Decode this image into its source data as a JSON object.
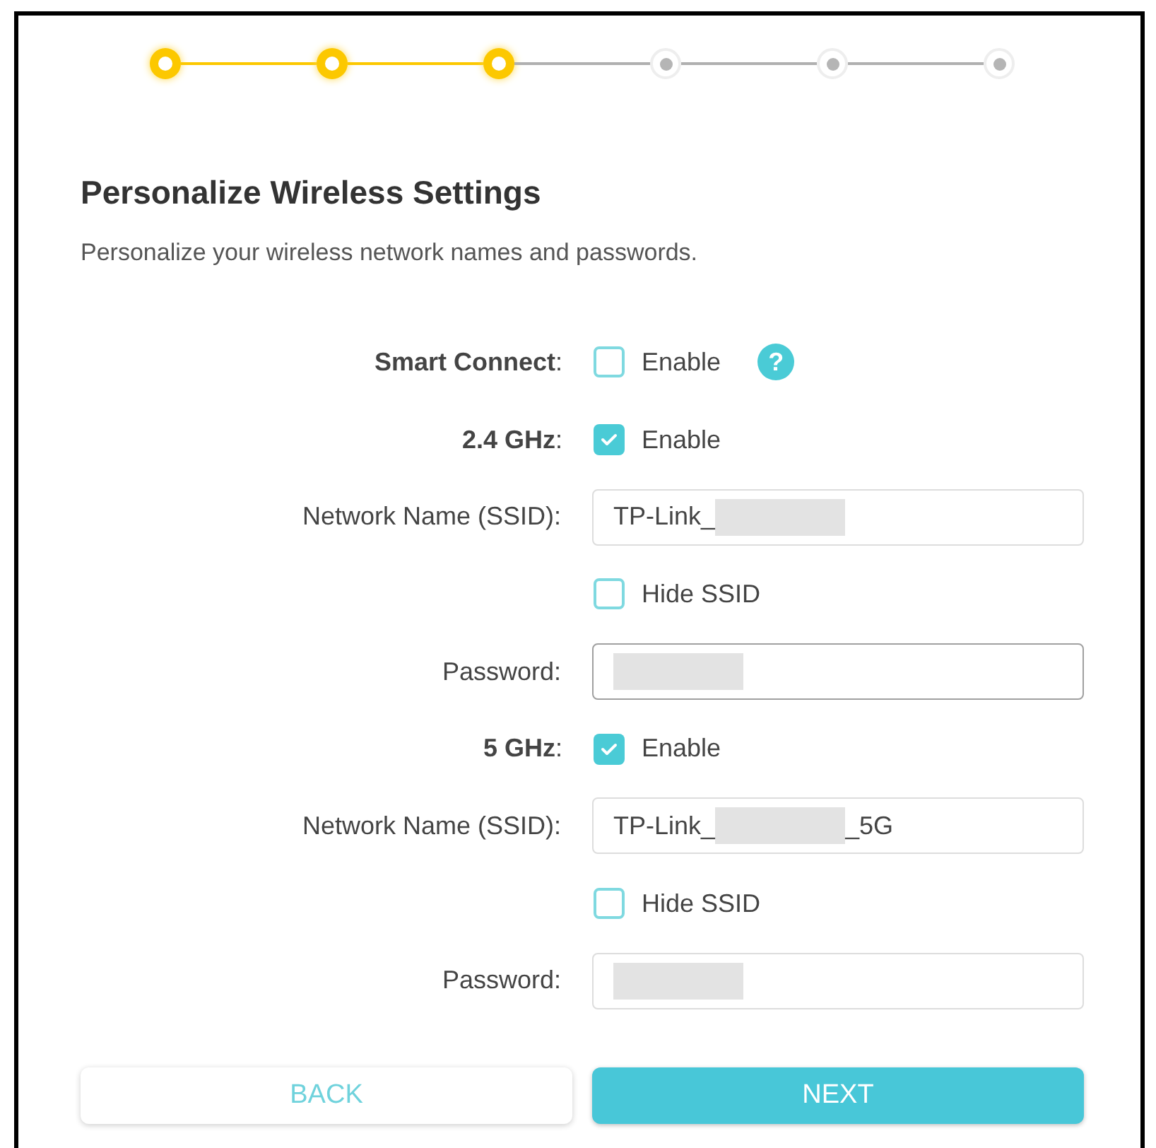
{
  "stepper": [
    {
      "completed": true
    },
    {
      "completed": true
    },
    {
      "completed": true
    },
    {
      "completed": false
    },
    {
      "completed": false
    },
    {
      "completed": false
    }
  ],
  "title": "Personalize Wireless Settings",
  "description": "Personalize your wireless network names and passwords.",
  "rows": [
    {
      "kind": "checkbox",
      "label": "**Smart Connect**:",
      "option": "Enable",
      "checked": false,
      "help": "?"
    },
    {
      "kind": "checkbox",
      "label": "**2.4 GHz**:",
      "option": "Enable",
      "checked": true
    },
    {
      "kind": "text",
      "label": "Network Name (SSID):",
      "value_start": "TP-Link_",
      "redacted": true
    },
    {
      "kind": "checkbox",
      "option": "Hide SSID",
      "checked": false
    },
    {
      "kind": "text",
      "label": "Password:",
      "redacted": true,
      "focused": true
    },
    {
      "kind": "checkbox",
      "label": "**5 GHz**:",
      "option": "Enable",
      "checked": true
    },
    {
      "kind": "text",
      "label": "Network Name (SSID):",
      "value_start": "TP-Link_",
      "redacted": true,
      "value_end": "_5G"
    },
    {
      "kind": "checkbox",
      "option": "Hide SSID",
      "checked": false
    },
    {
      "kind": "text",
      "label": "Password:",
      "redacted": true
    }
  ],
  "buttons": [
    {
      "label": "BACK",
      "primary": false
    },
    {
      "label": "NEXT",
      "primary": true
    }
  ]
}
